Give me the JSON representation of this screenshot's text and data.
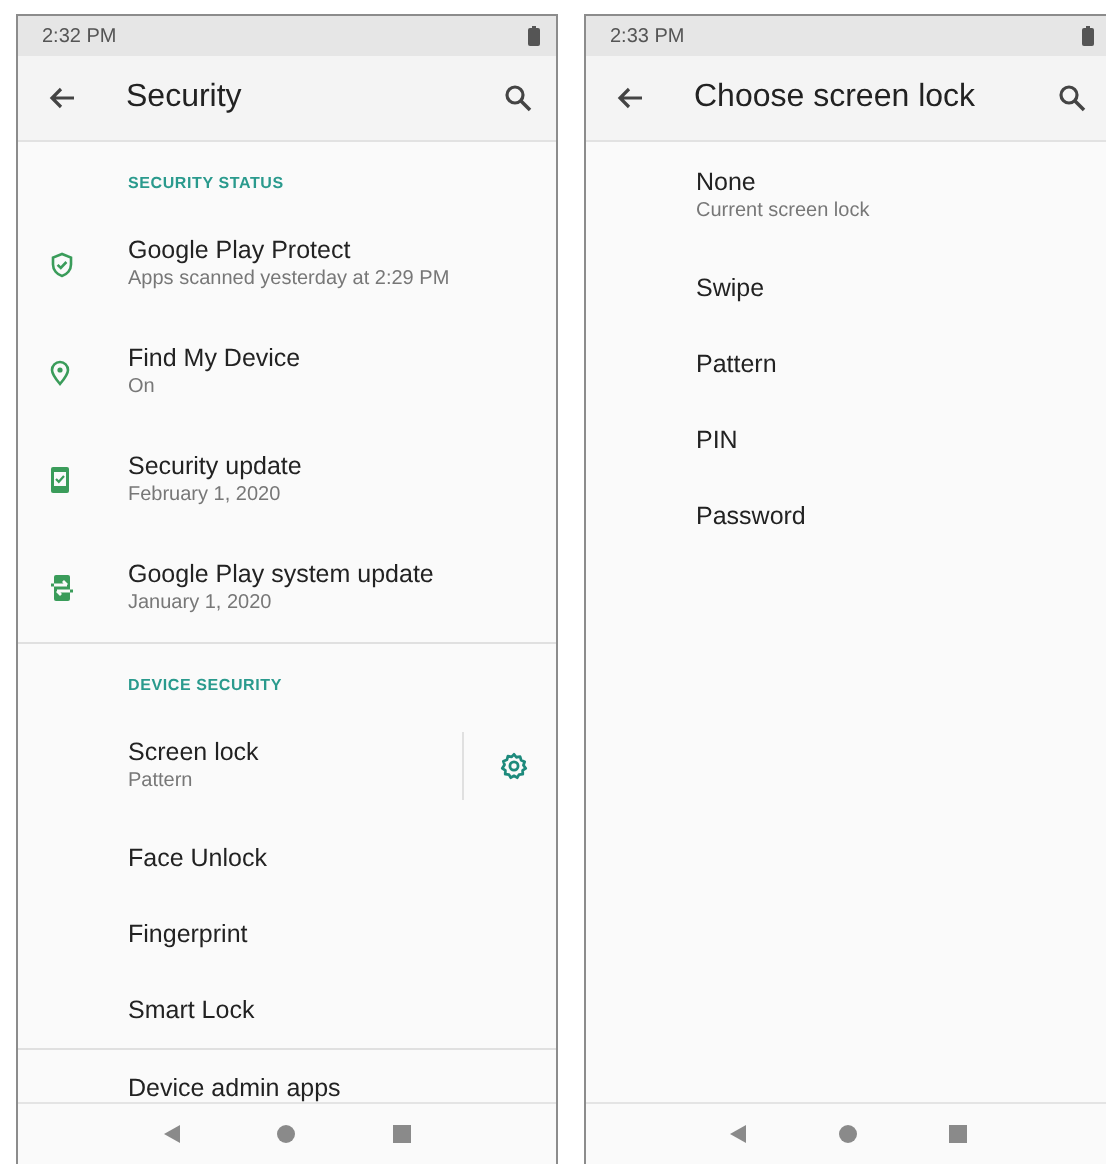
{
  "screens": [
    {
      "status_bar": {
        "time": "2:32 PM"
      },
      "toolbar": {
        "title": "Security"
      },
      "sections": [
        {
          "header": "SECURITY STATUS",
          "items": [
            {
              "title": "Google Play Protect",
              "subtitle": "Apps scanned yesterday at 2:29 PM"
            },
            {
              "title": "Find My Device",
              "subtitle": "On"
            },
            {
              "title": "Security update",
              "subtitle": "February 1, 2020"
            },
            {
              "title": "Google Play system update",
              "subtitle": "January 1, 2020"
            }
          ]
        },
        {
          "header": "DEVICE SECURITY",
          "items": [
            {
              "title": "Screen lock",
              "subtitle": "Pattern",
              "has_settings": true
            },
            {
              "title": "Face Unlock"
            },
            {
              "title": "Fingerprint"
            },
            {
              "title": "Smart Lock"
            }
          ]
        },
        {
          "items": [
            {
              "title": "Device admin apps"
            }
          ]
        }
      ]
    },
    {
      "status_bar": {
        "time": "2:33 PM"
      },
      "toolbar": {
        "title": "Choose screen lock"
      },
      "sections": [
        {
          "items": [
            {
              "title": "None",
              "subtitle": "Current screen lock"
            },
            {
              "title": "Swipe"
            },
            {
              "title": "Pattern"
            },
            {
              "title": "PIN"
            },
            {
              "title": "Password"
            }
          ]
        }
      ]
    }
  ]
}
